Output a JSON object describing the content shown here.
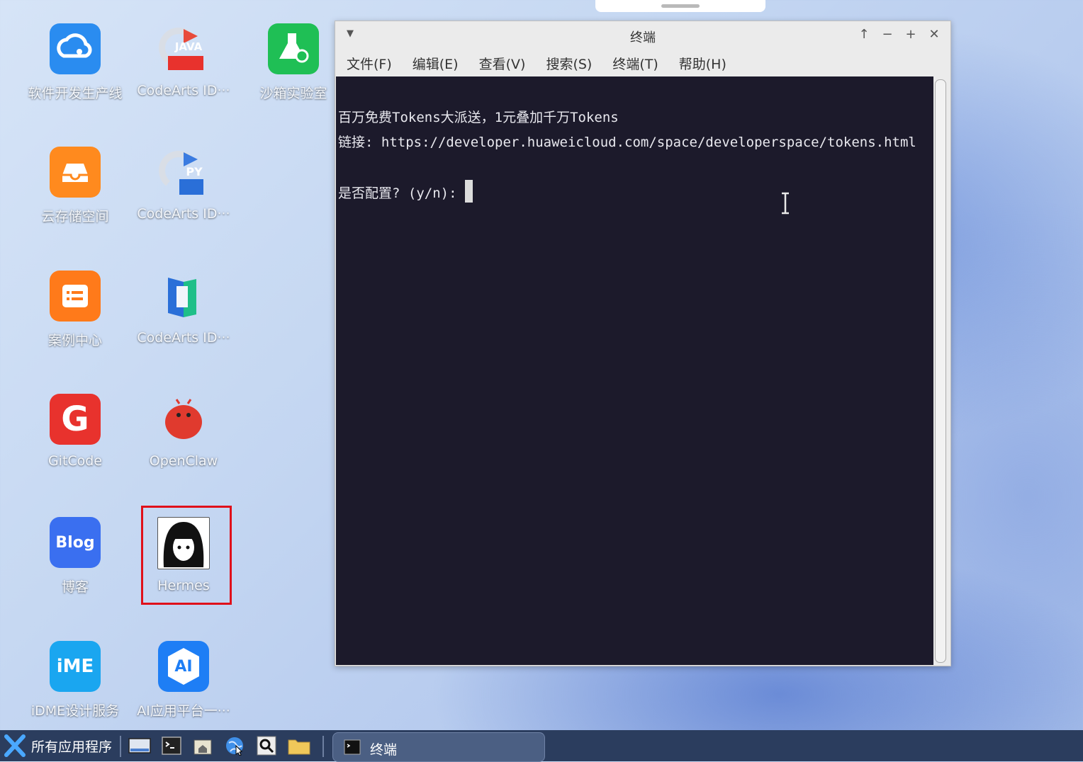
{
  "desktop": {
    "icons": [
      {
        "label": "软件开发生产线",
        "color": "#2a8cf0"
      },
      {
        "label": "CodeArts ID···",
        "badge": "JAVA"
      },
      {
        "label": "沙箱实验室",
        "color": "#1fbf55"
      },
      {
        "label": "云存储空间",
        "color": "#ff8a1e"
      },
      {
        "label": "CodeArts ID···",
        "badge": "PY"
      },
      {
        "label": "案例中心",
        "color": "#ff7a1a"
      },
      {
        "label": "CodeArts ID···"
      },
      {
        "label": "GitCode",
        "color": "#e8322d",
        "glyph": "G"
      },
      {
        "label": "OpenClaw"
      },
      {
        "label": "博客",
        "color": "#3a6ff0",
        "glyph": "Blog"
      },
      {
        "label": "Hermes"
      },
      {
        "label": "iDME设计服务",
        "color": "#1aa6f0",
        "glyph": "iME"
      },
      {
        "label": "AI应用平台一···",
        "color": "#1e7ef5",
        "glyph": "AI"
      }
    ]
  },
  "terminal": {
    "title": "终端",
    "menu": [
      "文件(F)",
      "编辑(E)",
      "查看(V)",
      "搜索(S)",
      "终端(T)",
      "帮助(H)"
    ],
    "lines": [
      "百万免费Tokens大派送，1元叠加千万Tokens",
      "链接: https://developer.huaweicloud.com/space/developerspace/tokens.html",
      "是否配置? (y/n): "
    ]
  },
  "taskbar": {
    "start_label": "所有应用程序",
    "task_label": "终端"
  }
}
